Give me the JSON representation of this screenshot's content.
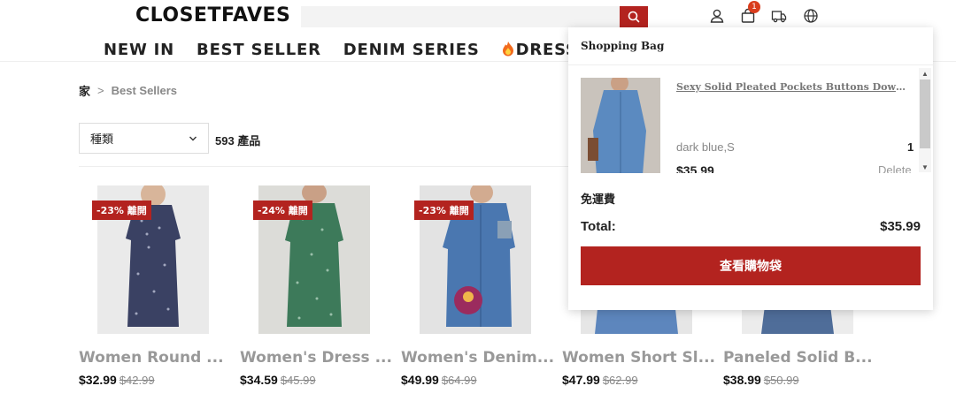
{
  "header": {
    "logo": "CLOSETFAVES",
    "search": {
      "placeholder": "",
      "value": ""
    },
    "cart_count": "1",
    "icons": [
      "user-icon",
      "shopping-bag-icon",
      "truck-icon",
      "globe-icon",
      "search-icon"
    ]
  },
  "nav": {
    "items": [
      "NEW IN",
      "BEST SELLER",
      "DENIM SERIES",
      "DRESSES"
    ]
  },
  "breadcrumb": {
    "home": "家",
    "separator": ">",
    "current": "Best Sellers"
  },
  "filter": {
    "label": "種類",
    "count": "593 產品"
  },
  "products": [
    {
      "tag": "-23% 離開",
      "title": "Women Round ...",
      "price": "$32.99",
      "old_price": "$42.99"
    },
    {
      "tag": "-24% 離開",
      "title": "Women's Dress ...",
      "price": "$34.59",
      "old_price": "$45.99"
    },
    {
      "tag": "-23% 離開",
      "title": "Women's Denim...",
      "price": "$49.99",
      "old_price": "$64.99"
    },
    {
      "tag": "",
      "title": "Women Short Sl...",
      "price": "$47.99",
      "old_price": "$62.99"
    },
    {
      "tag": "",
      "title": "Paneled Solid B...",
      "price": "$38.99",
      "old_price": "$50.99"
    }
  ],
  "cart": {
    "title": "Shopping Bag",
    "item": {
      "name": "Sexy Solid Pleated Pockets Buttons Down Shir...",
      "variant": "dark blue,S",
      "qty": "1",
      "price": "$35.99",
      "delete_label": "Delete"
    },
    "shipping": "免運費",
    "total_label": "Total:",
    "total_value": "$35.99",
    "checkout_label": "查看購物袋"
  },
  "colors": {
    "brand_red": "#b3231f",
    "badge_orange": "#d93d1d"
  }
}
